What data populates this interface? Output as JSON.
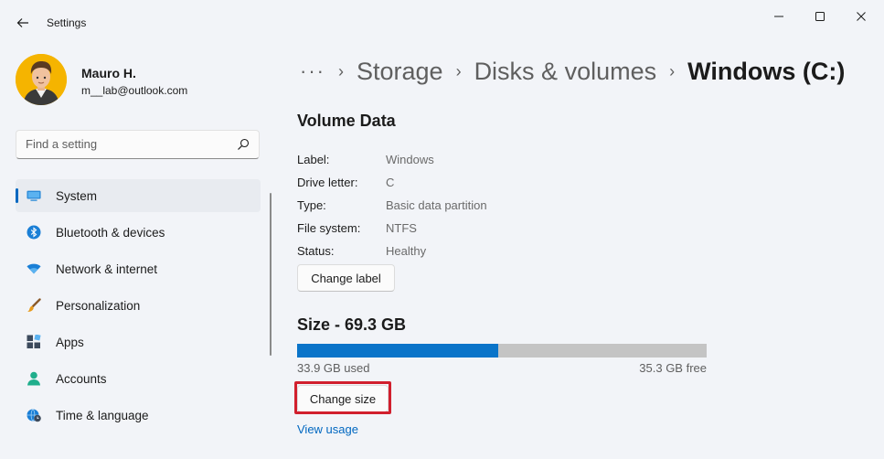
{
  "window": {
    "title": "Settings",
    "controls": {
      "minimize": "minimize",
      "maximize": "maximize",
      "close": "close"
    }
  },
  "account": {
    "name": "Mauro H.",
    "email": "m__lab@outlook.com"
  },
  "search": {
    "placeholder": "Find a setting",
    "icon": "search-icon"
  },
  "nav": {
    "items": [
      {
        "label": "System",
        "icon": "system-display-icon",
        "selected": true
      },
      {
        "label": "Bluetooth & devices",
        "icon": "bluetooth-icon"
      },
      {
        "label": "Network & internet",
        "icon": "wifi-icon"
      },
      {
        "label": "Personalization",
        "icon": "brush-icon"
      },
      {
        "label": "Apps",
        "icon": "apps-icon"
      },
      {
        "label": "Accounts",
        "icon": "accounts-icon"
      },
      {
        "label": "Time & language",
        "icon": "globe-clock-icon"
      }
    ],
    "accent": "#0067c0"
  },
  "breadcrumb": {
    "more": "···",
    "items": [
      "Storage",
      "Disks & volumes"
    ],
    "current": "Windows (C:)"
  },
  "volume": {
    "title": "Volume Data",
    "fields": [
      {
        "label": "Label:",
        "value": "Windows"
      },
      {
        "label": "Drive letter:",
        "value": "C"
      },
      {
        "label": "Type:",
        "value": "Basic data partition"
      },
      {
        "label": "File system:",
        "value": "NTFS"
      },
      {
        "label": "Status:",
        "value": "Healthy"
      }
    ],
    "change_label_button": "Change label"
  },
  "size": {
    "title": "Size - 69.3 GB",
    "used_text": "33.9 GB used",
    "free_text": "35.3 GB free",
    "used_fraction": 0.49,
    "bar_color": "#0a74c9",
    "change_size_button": "Change size",
    "view_usage_link": "View usage",
    "highlight_color": "#d11f2d"
  }
}
